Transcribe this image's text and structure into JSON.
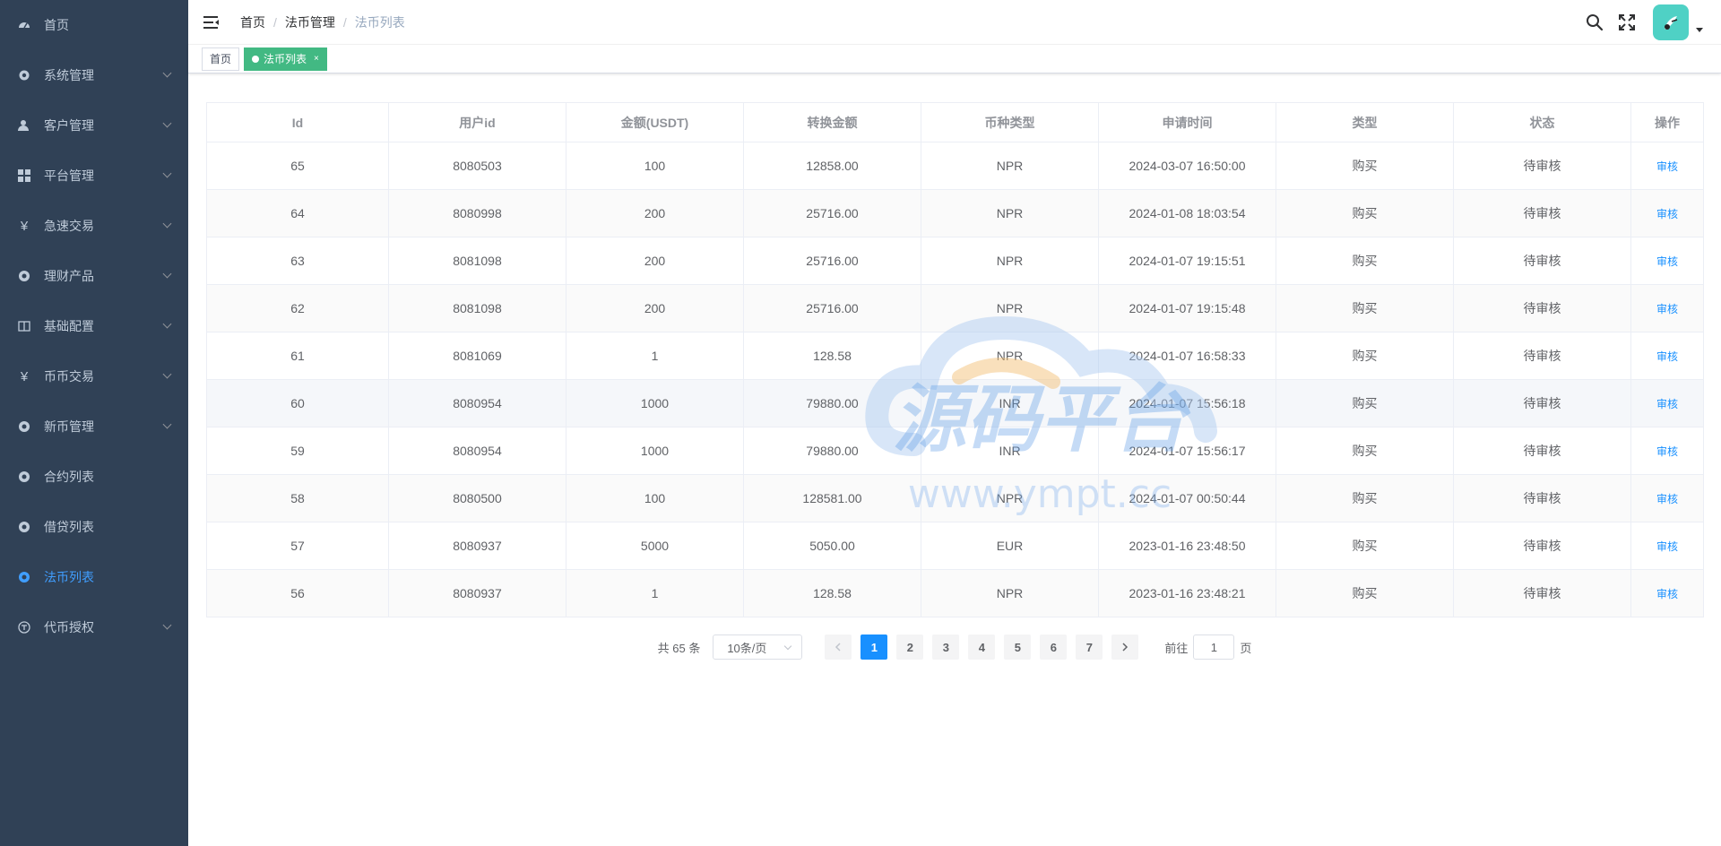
{
  "sidebar": {
    "items": [
      {
        "label": "首页",
        "icon": "dashboard-icon",
        "expandable": false,
        "active": false
      },
      {
        "label": "系统管理",
        "icon": "gear-icon",
        "expandable": true,
        "active": false
      },
      {
        "label": "客户管理",
        "icon": "user-icon",
        "expandable": true,
        "active": false
      },
      {
        "label": "平台管理",
        "icon": "grid-icon",
        "expandable": true,
        "active": false
      },
      {
        "label": "急速交易",
        "icon": "yen-icon",
        "expandable": true,
        "active": false
      },
      {
        "label": "理财产品",
        "icon": "circle-icon",
        "expandable": true,
        "active": false
      },
      {
        "label": "基础配置",
        "icon": "book-icon",
        "expandable": true,
        "active": false
      },
      {
        "label": "币币交易",
        "icon": "yen-icon",
        "expandable": true,
        "active": false
      },
      {
        "label": "新币管理",
        "icon": "circle-icon",
        "expandable": true,
        "active": false
      },
      {
        "label": "合约列表",
        "icon": "circle-icon",
        "expandable": false,
        "active": false
      },
      {
        "label": "借贷列表",
        "icon": "circle-icon",
        "expandable": false,
        "active": false
      },
      {
        "label": "法币列表",
        "icon": "circle-icon",
        "expandable": false,
        "active": true
      },
      {
        "label": "代币授权",
        "icon": "token-icon",
        "expandable": true,
        "active": false
      }
    ]
  },
  "breadcrumb": [
    "首页",
    "法币管理",
    "法币列表"
  ],
  "tags": [
    {
      "label": "首页",
      "active": false
    },
    {
      "label": "法币列表",
      "active": true,
      "close": "×"
    }
  ],
  "table": {
    "columns": [
      "Id",
      "用户id",
      "金额(USDT)",
      "转换金额",
      "币种类型",
      "申请时间",
      "类型",
      "状态",
      "操作"
    ],
    "rows": [
      [
        "65",
        "8080503",
        "100",
        "12858.00",
        "NPR",
        "2024-03-07 16:50:00",
        "购买",
        "待审核",
        "审核"
      ],
      [
        "64",
        "8080998",
        "200",
        "25716.00",
        "NPR",
        "2024-01-08 18:03:54",
        "购买",
        "待审核",
        "审核"
      ],
      [
        "63",
        "8081098",
        "200",
        "25716.00",
        "NPR",
        "2024-01-07 19:15:51",
        "购买",
        "待审核",
        "审核"
      ],
      [
        "62",
        "8081098",
        "200",
        "25716.00",
        "NPR",
        "2024-01-07 19:15:48",
        "购买",
        "待审核",
        "审核"
      ],
      [
        "61",
        "8081069",
        "1",
        "128.58",
        "NPR",
        "2024-01-07 16:58:33",
        "购买",
        "待审核",
        "审核"
      ],
      [
        "60",
        "8080954",
        "1000",
        "79880.00",
        "INR",
        "2024-01-07 15:56:18",
        "购买",
        "待审核",
        "审核"
      ],
      [
        "59",
        "8080954",
        "1000",
        "79880.00",
        "INR",
        "2024-01-07 15:56:17",
        "购买",
        "待审核",
        "审核"
      ],
      [
        "58",
        "8080500",
        "100",
        "128581.00",
        "NPR",
        "2024-01-07 00:50:44",
        "购买",
        "待审核",
        "审核"
      ],
      [
        "57",
        "8080937",
        "5000",
        "5050.00",
        "EUR",
        "2023-01-16 23:48:50",
        "购买",
        "待审核",
        "审核"
      ],
      [
        "56",
        "8080937",
        "1",
        "128.58",
        "NPR",
        "2023-01-16 23:48:21",
        "购买",
        "待审核",
        "审核"
      ]
    ]
  },
  "pagination": {
    "total": "共 65 条",
    "page_size": "10条/页",
    "pages": [
      "1",
      "2",
      "3",
      "4",
      "5",
      "6",
      "7"
    ],
    "current": "1",
    "goto_prefix": "前往",
    "goto_value": "1",
    "goto_suffix": "页"
  },
  "watermark": {
    "text": "源码平台",
    "url": "www.ympt.cc"
  },
  "colors": {
    "sidebar_bg": "#304156",
    "accent": "#1890ff",
    "tag_active": "#42b983"
  }
}
